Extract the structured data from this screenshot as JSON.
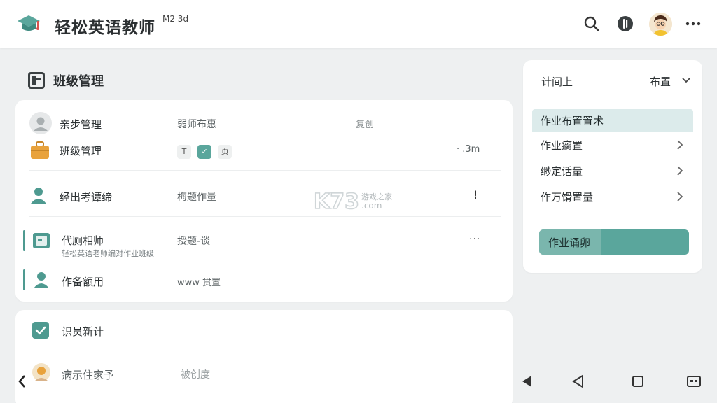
{
  "app": {
    "title": "轻松英语教师",
    "title_sup": "M2 3d"
  },
  "section": {
    "title": "班级管理"
  },
  "main_rows": [
    {
      "label": "亲步管理",
      "value": "弱师布惠",
      "extra": "复创"
    },
    {
      "label": "班级管理",
      "chips": [
        "T",
        "✓",
        "页"
      ],
      "extra": "· .3m"
    },
    {
      "label": "经出考谭缔",
      "value": "梅题作量",
      "extra": "!"
    },
    {
      "label": "代厕相师",
      "sub": "轻松英语老师编对作业班级",
      "value": "授题-谈",
      "extra": "···"
    },
    {
      "label": "作备额用",
      "value": "www 贯置"
    }
  ],
  "second_card": {
    "rows": [
      {
        "label": "识员新计"
      },
      {
        "label": "病示住家予",
        "value": "被创度"
      }
    ]
  },
  "side": {
    "top_label": "计间上",
    "dropdown_label": "布置",
    "menu_header": "作业布置置术",
    "menu_items": [
      "作业瘸置",
      "缈定话量",
      "作万馉置量"
    ],
    "button_label": "作业诵卵"
  },
  "watermark": {
    "brand": "K73",
    "site": "游戏之家",
    "domain": ".com"
  },
  "colors": {
    "accent": "#5aa69c",
    "accent_light": "#dcebeb",
    "background": "#eef0f1"
  },
  "icons": {
    "logo": "graduation-cap-icon",
    "search": "search-icon",
    "mic": "mic-icon",
    "more": "more-icon"
  }
}
